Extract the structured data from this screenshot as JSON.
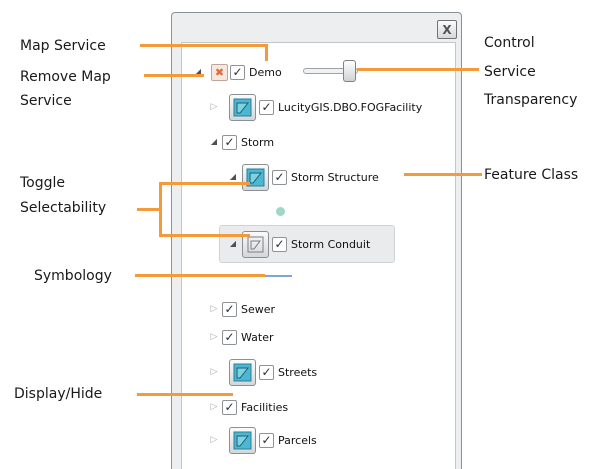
{
  "panel": {
    "close_label": "X"
  },
  "service": {
    "remove_icon": "✖",
    "check": "✓",
    "label": "Demo",
    "transparency_slider": 0.8
  },
  "tree": {
    "fog_facility": "LucityGIS.DBO.FOGFacility",
    "storm": "Storm",
    "storm_structure": "Storm Structure",
    "storm_conduit": "Storm Conduit",
    "sewer": "Sewer",
    "water": "Water",
    "streets": "Streets",
    "facilities": "Facilities",
    "parcels": "Parcels"
  },
  "glyphs": {
    "collapsed": "▷",
    "expanded": "◢",
    "check": "✓"
  },
  "colors": {
    "callout_line": "#f39a3a",
    "selectable_icon": "#4bb7d0"
  },
  "callouts": {
    "map_service": "Map Service",
    "remove_map_service_1": "Remove Map",
    "remove_map_service_2": "Service",
    "toggle_1": "Toggle",
    "toggle_2": "Selectability",
    "symbology": "Symbology",
    "display_hide": "Display/Hide",
    "control_1": "Control",
    "control_2": "Service",
    "control_3": "Transparency",
    "feature_class": "Feature Class"
  }
}
